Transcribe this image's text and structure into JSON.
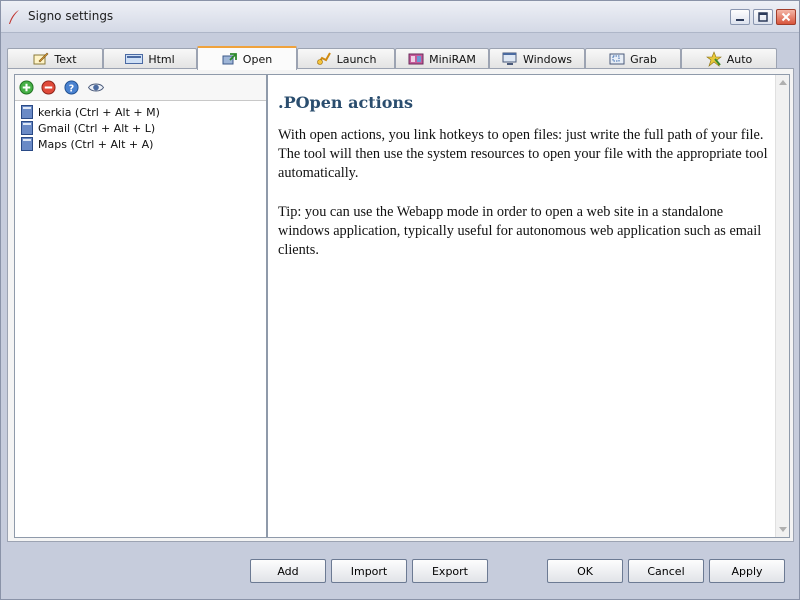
{
  "window": {
    "title": "Signo settings"
  },
  "tabs": [
    {
      "label": "Text",
      "icon": "text-edit-icon"
    },
    {
      "label": "Html",
      "icon": "html-icon"
    },
    {
      "label": "Open",
      "icon": "open-icon",
      "active": true
    },
    {
      "label": "Launch",
      "icon": "launch-icon"
    },
    {
      "label": "MiniRAM",
      "icon": "miniram-icon"
    },
    {
      "label": "Windows",
      "icon": "windows-icon"
    },
    {
      "label": "Grab",
      "icon": "grab-icon"
    },
    {
      "label": "Auto",
      "icon": "auto-icon"
    }
  ],
  "list_toolbar": {
    "icons": [
      "add-icon",
      "remove-icon",
      "help-icon",
      "view-icon"
    ]
  },
  "items": [
    {
      "label": "kerkia (Ctrl + Alt + M)"
    },
    {
      "label": "Gmail (Ctrl + Alt + L)"
    },
    {
      "label": "Maps (Ctrl + Alt + A)"
    }
  ],
  "help": {
    "heading": ".POpen actions",
    "paragraph1": "With open actions, you link hotkeys to open files: just write the full path of your file. The tool will then use the system resources to open your file with the appropriate tool automatically.",
    "paragraph2": "Tip: you can use the Webapp mode in order to open a web site in a standalone windows application, typically useful for autonomous web application such as email clients."
  },
  "buttons": {
    "add": "Add",
    "import": "Import",
    "export": "Export",
    "ok": "OK",
    "cancel": "Cancel",
    "apply": "Apply"
  },
  "colors": {
    "heading": "#2a4d6e",
    "active_tab_accent": "#f0a23c",
    "window_frame": "#c6ccdc"
  }
}
